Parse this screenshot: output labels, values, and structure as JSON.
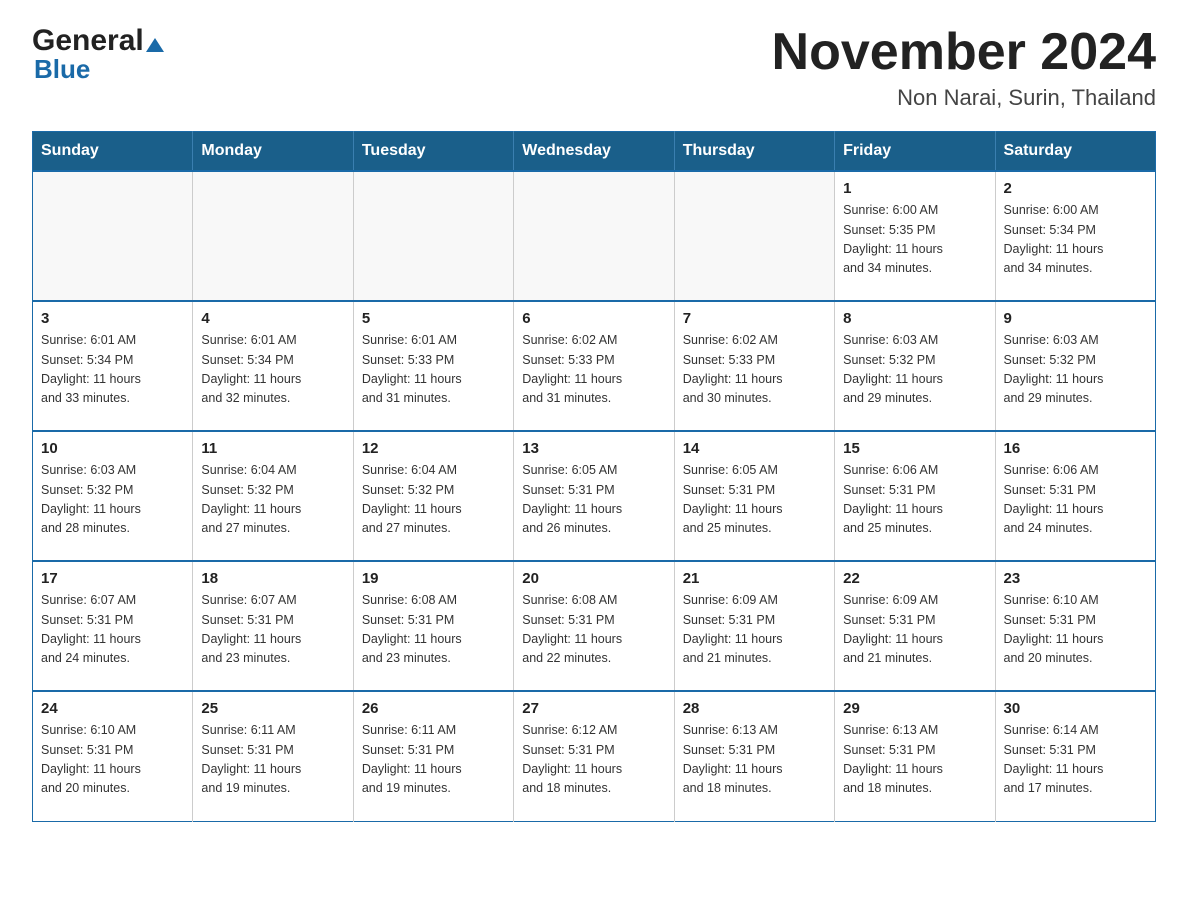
{
  "header": {
    "logo_general": "General",
    "logo_blue": "Blue",
    "title": "November 2024",
    "subtitle": "Non Narai, Surin, Thailand"
  },
  "weekdays": [
    "Sunday",
    "Monday",
    "Tuesday",
    "Wednesday",
    "Thursday",
    "Friday",
    "Saturday"
  ],
  "weeks": [
    [
      {
        "day": "",
        "info": ""
      },
      {
        "day": "",
        "info": ""
      },
      {
        "day": "",
        "info": ""
      },
      {
        "day": "",
        "info": ""
      },
      {
        "day": "",
        "info": ""
      },
      {
        "day": "1",
        "info": "Sunrise: 6:00 AM\nSunset: 5:35 PM\nDaylight: 11 hours\nand 34 minutes."
      },
      {
        "day": "2",
        "info": "Sunrise: 6:00 AM\nSunset: 5:34 PM\nDaylight: 11 hours\nand 34 minutes."
      }
    ],
    [
      {
        "day": "3",
        "info": "Sunrise: 6:01 AM\nSunset: 5:34 PM\nDaylight: 11 hours\nand 33 minutes."
      },
      {
        "day": "4",
        "info": "Sunrise: 6:01 AM\nSunset: 5:34 PM\nDaylight: 11 hours\nand 32 minutes."
      },
      {
        "day": "5",
        "info": "Sunrise: 6:01 AM\nSunset: 5:33 PM\nDaylight: 11 hours\nand 31 minutes."
      },
      {
        "day": "6",
        "info": "Sunrise: 6:02 AM\nSunset: 5:33 PM\nDaylight: 11 hours\nand 31 minutes."
      },
      {
        "day": "7",
        "info": "Sunrise: 6:02 AM\nSunset: 5:33 PM\nDaylight: 11 hours\nand 30 minutes."
      },
      {
        "day": "8",
        "info": "Sunrise: 6:03 AM\nSunset: 5:32 PM\nDaylight: 11 hours\nand 29 minutes."
      },
      {
        "day": "9",
        "info": "Sunrise: 6:03 AM\nSunset: 5:32 PM\nDaylight: 11 hours\nand 29 minutes."
      }
    ],
    [
      {
        "day": "10",
        "info": "Sunrise: 6:03 AM\nSunset: 5:32 PM\nDaylight: 11 hours\nand 28 minutes."
      },
      {
        "day": "11",
        "info": "Sunrise: 6:04 AM\nSunset: 5:32 PM\nDaylight: 11 hours\nand 27 minutes."
      },
      {
        "day": "12",
        "info": "Sunrise: 6:04 AM\nSunset: 5:32 PM\nDaylight: 11 hours\nand 27 minutes."
      },
      {
        "day": "13",
        "info": "Sunrise: 6:05 AM\nSunset: 5:31 PM\nDaylight: 11 hours\nand 26 minutes."
      },
      {
        "day": "14",
        "info": "Sunrise: 6:05 AM\nSunset: 5:31 PM\nDaylight: 11 hours\nand 25 minutes."
      },
      {
        "day": "15",
        "info": "Sunrise: 6:06 AM\nSunset: 5:31 PM\nDaylight: 11 hours\nand 25 minutes."
      },
      {
        "day": "16",
        "info": "Sunrise: 6:06 AM\nSunset: 5:31 PM\nDaylight: 11 hours\nand 24 minutes."
      }
    ],
    [
      {
        "day": "17",
        "info": "Sunrise: 6:07 AM\nSunset: 5:31 PM\nDaylight: 11 hours\nand 24 minutes."
      },
      {
        "day": "18",
        "info": "Sunrise: 6:07 AM\nSunset: 5:31 PM\nDaylight: 11 hours\nand 23 minutes."
      },
      {
        "day": "19",
        "info": "Sunrise: 6:08 AM\nSunset: 5:31 PM\nDaylight: 11 hours\nand 23 minutes."
      },
      {
        "day": "20",
        "info": "Sunrise: 6:08 AM\nSunset: 5:31 PM\nDaylight: 11 hours\nand 22 minutes."
      },
      {
        "day": "21",
        "info": "Sunrise: 6:09 AM\nSunset: 5:31 PM\nDaylight: 11 hours\nand 21 minutes."
      },
      {
        "day": "22",
        "info": "Sunrise: 6:09 AM\nSunset: 5:31 PM\nDaylight: 11 hours\nand 21 minutes."
      },
      {
        "day": "23",
        "info": "Sunrise: 6:10 AM\nSunset: 5:31 PM\nDaylight: 11 hours\nand 20 minutes."
      }
    ],
    [
      {
        "day": "24",
        "info": "Sunrise: 6:10 AM\nSunset: 5:31 PM\nDaylight: 11 hours\nand 20 minutes."
      },
      {
        "day": "25",
        "info": "Sunrise: 6:11 AM\nSunset: 5:31 PM\nDaylight: 11 hours\nand 19 minutes."
      },
      {
        "day": "26",
        "info": "Sunrise: 6:11 AM\nSunset: 5:31 PM\nDaylight: 11 hours\nand 19 minutes."
      },
      {
        "day": "27",
        "info": "Sunrise: 6:12 AM\nSunset: 5:31 PM\nDaylight: 11 hours\nand 18 minutes."
      },
      {
        "day": "28",
        "info": "Sunrise: 6:13 AM\nSunset: 5:31 PM\nDaylight: 11 hours\nand 18 minutes."
      },
      {
        "day": "29",
        "info": "Sunrise: 6:13 AM\nSunset: 5:31 PM\nDaylight: 11 hours\nand 18 minutes."
      },
      {
        "day": "30",
        "info": "Sunrise: 6:14 AM\nSunset: 5:31 PM\nDaylight: 11 hours\nand 17 minutes."
      }
    ]
  ]
}
